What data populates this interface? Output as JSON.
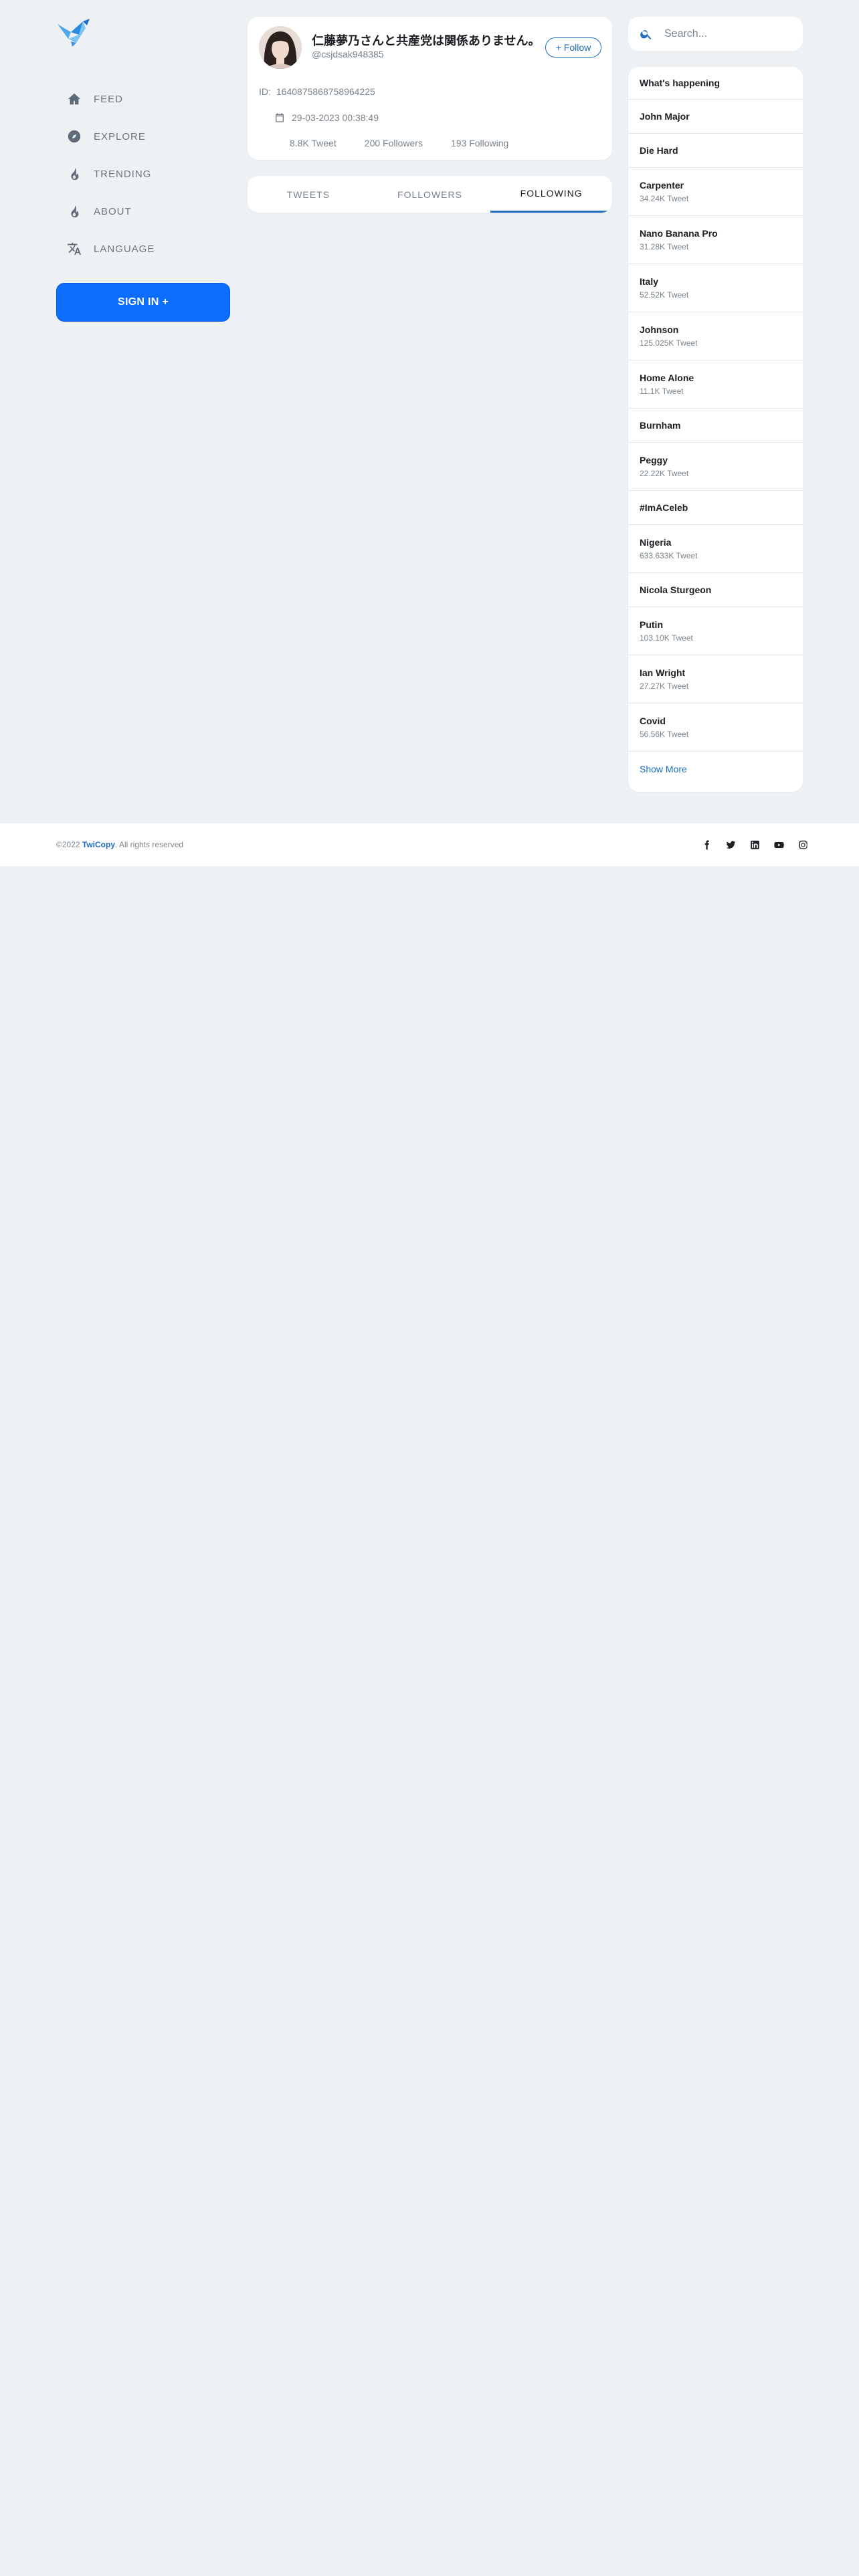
{
  "brand": {
    "name": "TwiCopy"
  },
  "nav": {
    "items": [
      {
        "label": "FEED",
        "icon": "home-icon"
      },
      {
        "label": "EXPLORE",
        "icon": "compass-icon"
      },
      {
        "label": "TRENDING",
        "icon": "flame-icon"
      },
      {
        "label": "ABOUT",
        "icon": "flame-icon"
      },
      {
        "label": "LANGUAGE",
        "icon": "translate-icon"
      }
    ],
    "signin_label": "SIGN IN +"
  },
  "profile": {
    "name": "仁藤夢乃さんと共産党は関係ありません。",
    "handle": "@csjdsak948385",
    "follow_label": "+ Follow",
    "id_label": "ID:",
    "id_value": "1640875868758964225",
    "joined": "29-03-2023 00:38:49",
    "stats": {
      "tweets": "8.8K Tweet",
      "followers": "200 Followers",
      "following": "193 Following"
    }
  },
  "tabs": [
    {
      "label": "TWEETS",
      "active": false
    },
    {
      "label": "FOLLOWERS",
      "active": false
    },
    {
      "label": "FOLLOWING",
      "active": true
    }
  ],
  "search": {
    "placeholder": "Search..."
  },
  "trends": {
    "heading": "What's happening",
    "items": [
      {
        "title": "John Major",
        "count": ""
      },
      {
        "title": "Die Hard",
        "count": ""
      },
      {
        "title": "Carpenter",
        "count": "34.24K Tweet"
      },
      {
        "title": "Nano Banana Pro",
        "count": "31.28K Tweet"
      },
      {
        "title": "Italy",
        "count": "52.52K Tweet"
      },
      {
        "title": "Johnson",
        "count": "125.025K Tweet"
      },
      {
        "title": "Home Alone",
        "count": "11.1K Tweet"
      },
      {
        "title": "Burnham",
        "count": ""
      },
      {
        "title": "Peggy",
        "count": "22.22K Tweet"
      },
      {
        "title": "#ImACeleb",
        "count": ""
      },
      {
        "title": "Nigeria",
        "count": "633.633K Tweet"
      },
      {
        "title": "Nicola Sturgeon",
        "count": ""
      },
      {
        "title": "Putin",
        "count": "103.10K Tweet"
      },
      {
        "title": "Ian Wright",
        "count": "27.27K Tweet"
      },
      {
        "title": "Covid",
        "count": "56.56K Tweet"
      }
    ],
    "show_more": "Show More"
  },
  "footer": {
    "year": "©2022",
    "brand": "TwiCopy",
    "rights": ". All rights reserved",
    "social": [
      "facebook-icon",
      "twitter-icon",
      "linkedin-icon",
      "youtube-icon",
      "instagram-icon"
    ]
  },
  "colors": {
    "accent": "#1b6ec2",
    "signin": "#0d6efd",
    "background": "#edf1f4"
  }
}
